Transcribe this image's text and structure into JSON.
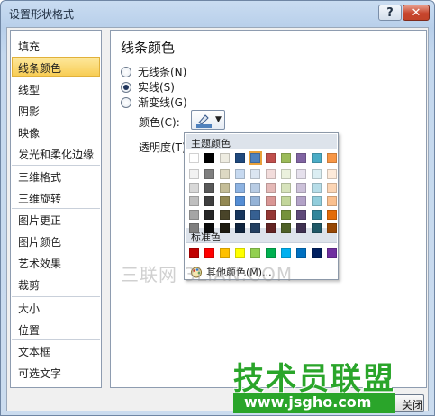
{
  "window": {
    "title": "设置形状格式",
    "help_label": "?",
    "close_label": "✕"
  },
  "sidebar": {
    "items": [
      {
        "label": "填充"
      },
      {
        "label": "线条颜色",
        "selected": true
      },
      {
        "label": "线型"
      },
      {
        "label": "阴影"
      },
      {
        "label": "映像"
      },
      {
        "label": "发光和柔化边缘"
      },
      {
        "label": "三维格式"
      },
      {
        "label": "三维旋转"
      },
      {
        "label": "图片更正"
      },
      {
        "label": "图片颜色"
      },
      {
        "label": "艺术效果"
      },
      {
        "label": "裁剪"
      },
      {
        "label": "大小"
      },
      {
        "label": "位置"
      },
      {
        "label": "文本框"
      },
      {
        "label": "可选文字"
      }
    ]
  },
  "panel": {
    "title": "线条颜色",
    "options": [
      {
        "label": "无线条(N)",
        "checked": false
      },
      {
        "label": "实线(S)",
        "checked": true
      },
      {
        "label": "渐变线(G)",
        "checked": false
      }
    ],
    "color_label": "颜色(C):",
    "transparency_label": "透明度(T):",
    "current_color": "#4f81bd"
  },
  "color_picker": {
    "theme_header": "主题颜色",
    "standard_header": "标准色",
    "more_colors": "其他颜色(M)...",
    "selected_theme_index": 4,
    "theme_colors": [
      "#ffffff",
      "#000000",
      "#eeece1",
      "#1f497d",
      "#4f81bd",
      "#c0504d",
      "#9bbb59",
      "#8064a2",
      "#4bacc6",
      "#f79646"
    ],
    "theme_shades": [
      [
        "#f2f2f2",
        "#d8d8d8",
        "#bfbfbf",
        "#a5a5a5",
        "#7f7f7f"
      ],
      [
        "#7f7f7f",
        "#595959",
        "#3f3f3f",
        "#262626",
        "#0c0c0c"
      ],
      [
        "#ddd9c3",
        "#c4bd97",
        "#938953",
        "#494429",
        "#1d1b10"
      ],
      [
        "#c6d9f0",
        "#8db3e2",
        "#548dd4",
        "#17365d",
        "#0f243e"
      ],
      [
        "#dbe5f1",
        "#b8cce4",
        "#95b3d7",
        "#366092",
        "#244061"
      ],
      [
        "#f2dcdb",
        "#e5b9b7",
        "#d99694",
        "#953734",
        "#632423"
      ],
      [
        "#ebf1dd",
        "#d7e3bc",
        "#c3d69b",
        "#76923c",
        "#4f6128"
      ],
      [
        "#e5e0ec",
        "#ccc1d9",
        "#b2a2c7",
        "#5f497a",
        "#3f3151"
      ],
      [
        "#dbeef3",
        "#b7dde8",
        "#92cddc",
        "#31859b",
        "#205867"
      ],
      [
        "#fdeada",
        "#fbd5b5",
        "#fac08f",
        "#e36c09",
        "#974806"
      ]
    ],
    "standard_colors": [
      "#c00000",
      "#ff0000",
      "#ffc000",
      "#ffff00",
      "#92d050",
      "#00b050",
      "#00b0f0",
      "#0070c0",
      "#002060",
      "#7030a0"
    ]
  },
  "watermark": {
    "text1": "三联网 3LIAN.COM",
    "text2": "技术员联盟",
    "text3": "www.jsgho.com"
  },
  "footer": {
    "close_button": "关闭"
  }
}
